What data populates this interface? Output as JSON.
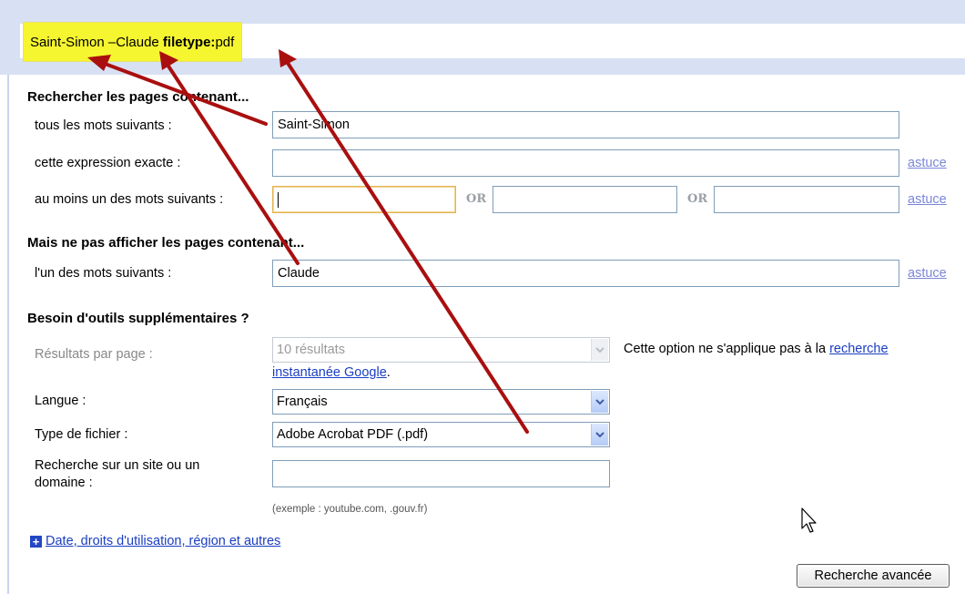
{
  "query": {
    "part1": "Saint-Simon",
    "part2": " –Claude ",
    "operator": "filetype:",
    "operator_value": "pdf"
  },
  "section1": {
    "heading": "Rechercher les pages contenant...",
    "all_words_label": "tous les mots suivants :",
    "all_words_value": "Saint-Simon",
    "exact_label": "cette expression exacte :",
    "exact_value": "",
    "any_label": "au moins un des mots suivants :",
    "any_values": [
      "",
      "",
      ""
    ],
    "or_label": "OR",
    "tip": "astuce"
  },
  "section2": {
    "heading": "Mais ne pas afficher les pages contenant...",
    "none_label": "l'un des mots suivants :",
    "none_value": "Claude",
    "tip": "astuce"
  },
  "section3": {
    "heading": "Besoin d'outils supplémentaires ?",
    "results_label": "Résultats par page :",
    "results_value": "10 résultats",
    "results_note": "Cette option ne s'applique pas à la ",
    "results_note_link1": "recherche",
    "results_note_link2": "instantanée Google",
    "results_note_end": ".",
    "language_label": "Langue :",
    "language_value": "Français",
    "filetype_label": "Type de fichier :",
    "filetype_value": "Adobe Acrobat PDF (.pdf)",
    "site_label": "Recherche sur un site ou un domaine :",
    "site_value": "",
    "site_hint": "(exemple : youtube.com, .gouv.fr)"
  },
  "more_link": "Date, droits d'utilisation, région et autres",
  "submit_label": "Recherche avancée",
  "colors": {
    "highlight": "#f6f630",
    "arrow": "#a90f0f",
    "link": "#1a3ec2",
    "tip": "#7b86d8",
    "top_band": "#d8e0f3"
  },
  "icons": [
    "plus-icon",
    "chevron-down-icon",
    "mouse-cursor-icon",
    "annotation-arrow"
  ]
}
